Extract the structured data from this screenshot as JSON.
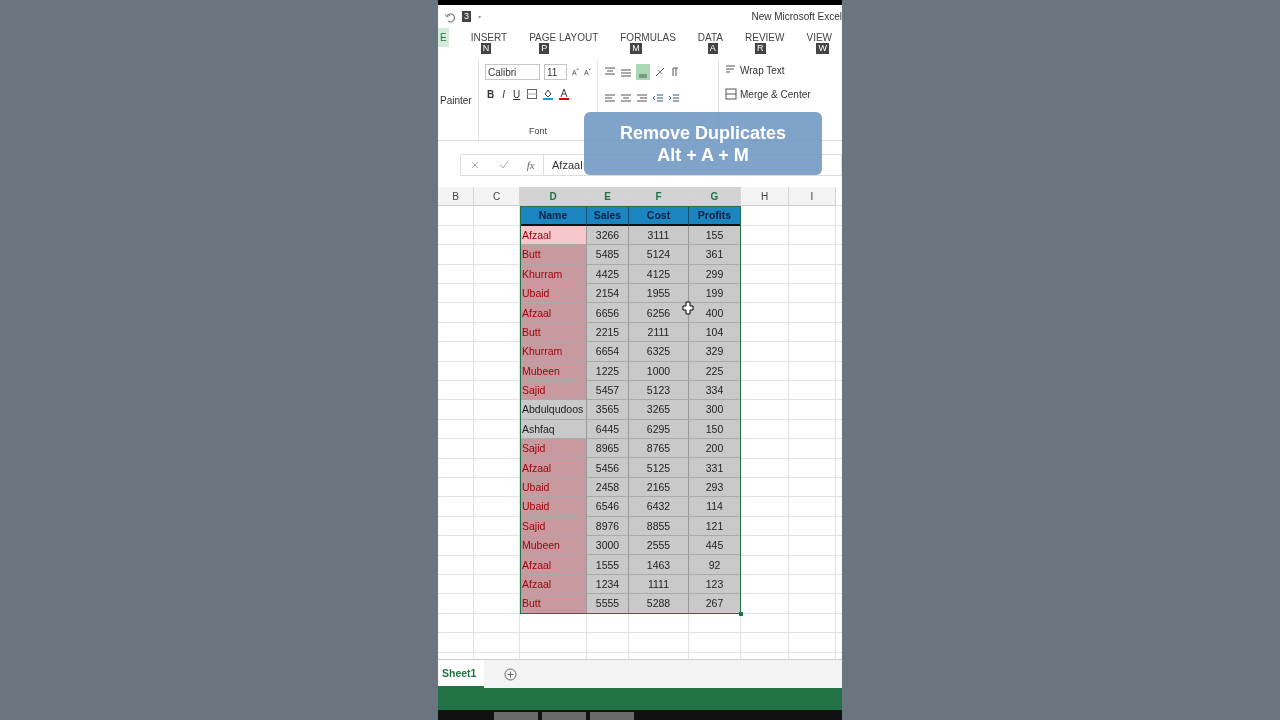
{
  "title_bar": {
    "quick_access_key": "3",
    "title": "New Microsoft Excel"
  },
  "tabs": [
    {
      "label": "E",
      "kind": "file"
    },
    {
      "label": "INSERT",
      "key_tip": "N",
      "kind": "tab"
    },
    {
      "label": "PAGE LAYOUT",
      "key_tip": "P",
      "kind": "tab"
    },
    {
      "label": "FORMULAS",
      "key_tip": "M",
      "kind": "tab"
    },
    {
      "label": "DATA",
      "key_tip": "A",
      "kind": "tab"
    },
    {
      "label": "REVIEW",
      "key_tip": "R",
      "kind": "tab"
    },
    {
      "label": "VIEW",
      "key_tip": "W",
      "kind": "tab"
    }
  ],
  "ribbon": {
    "painter": "Painter",
    "font_name": "Calibri",
    "font_size": "11",
    "format_buttons": [
      "B",
      "I",
      "U"
    ],
    "wrap_text": "Wrap Text",
    "merge_center": "Merge & Center",
    "font_group": "Font"
  },
  "overlay": {
    "lines": [
      "Remove Duplicates",
      "Alt + A + M"
    ]
  },
  "formula_bar": {
    "fx": "fx",
    "value": "Afzaal"
  },
  "sheet": {
    "columns": [
      {
        "label": "B",
        "selected": false
      },
      {
        "label": "C",
        "selected": false
      },
      {
        "label": "D",
        "selected": true
      },
      {
        "label": "E",
        "selected": true
      },
      {
        "label": "F",
        "selected": true
      },
      {
        "label": "G",
        "selected": true
      },
      {
        "label": "H",
        "selected": false
      },
      {
        "label": "I",
        "selected": false
      }
    ],
    "header": [
      "Name",
      "Sales",
      "Cost",
      "Profits"
    ],
    "rows": [
      {
        "name": "Afzaal",
        "values": [
          "3266",
          "3111",
          "155"
        ],
        "duplicate": true,
        "active": true
      },
      {
        "name": "Butt",
        "values": [
          "5485",
          "5124",
          "361"
        ],
        "duplicate": true,
        "active": false
      },
      {
        "name": "Khurram",
        "values": [
          "4425",
          "4125",
          "299"
        ],
        "duplicate": true,
        "active": false
      },
      {
        "name": "Ubaid",
        "values": [
          "2154",
          "1955",
          "199"
        ],
        "duplicate": true,
        "active": false
      },
      {
        "name": "Afzaal",
        "values": [
          "6656",
          "6256",
          "400"
        ],
        "duplicate": true,
        "active": false
      },
      {
        "name": "Butt",
        "values": [
          "2215",
          "2111",
          "104"
        ],
        "duplicate": true,
        "active": false
      },
      {
        "name": "Khurram",
        "values": [
          "6654",
          "6325",
          "329"
        ],
        "duplicate": true,
        "active": false
      },
      {
        "name": "Mubeen",
        "values": [
          "1225",
          "1000",
          "225"
        ],
        "duplicate": true,
        "active": false
      },
      {
        "name": "Sajid",
        "values": [
          "5457",
          "5123",
          "334"
        ],
        "duplicate": true,
        "active": false
      },
      {
        "name": "Abdulqudoos",
        "values": [
          "3565",
          "3265",
          "300"
        ],
        "duplicate": false,
        "active": false
      },
      {
        "name": "Ashfaq",
        "values": [
          "6445",
          "6295",
          "150"
        ],
        "duplicate": false,
        "active": false
      },
      {
        "name": "Sajid",
        "values": [
          "8965",
          "8765",
          "200"
        ],
        "duplicate": true,
        "active": false
      },
      {
        "name": "Afzaal",
        "values": [
          "5456",
          "5125",
          "331"
        ],
        "duplicate": true,
        "active": false
      },
      {
        "name": "Ubaid",
        "values": [
          "2458",
          "2165",
          "293"
        ],
        "duplicate": true,
        "active": false
      },
      {
        "name": "Ubaid",
        "values": [
          "6546",
          "6432",
          "114"
        ],
        "duplicate": true,
        "active": false
      },
      {
        "name": "Sajid",
        "values": [
          "8976",
          "8855",
          "121"
        ],
        "duplicate": true,
        "active": false
      },
      {
        "name": "Mubeen",
        "values": [
          "3000",
          "2555",
          "445"
        ],
        "duplicate": true,
        "active": false
      },
      {
        "name": "Afzaal",
        "values": [
          "1555",
          "1463",
          "92"
        ],
        "duplicate": true,
        "active": false
      },
      {
        "name": "Afzaal",
        "values": [
          "1234",
          "1111",
          "123"
        ],
        "duplicate": true,
        "active": false
      },
      {
        "name": "Butt",
        "values": [
          "5555",
          "5288",
          "267"
        ],
        "duplicate": true,
        "active": false
      }
    ]
  },
  "sheet_tabs": [
    {
      "label": "Sheet1",
      "selected": true
    }
  ]
}
